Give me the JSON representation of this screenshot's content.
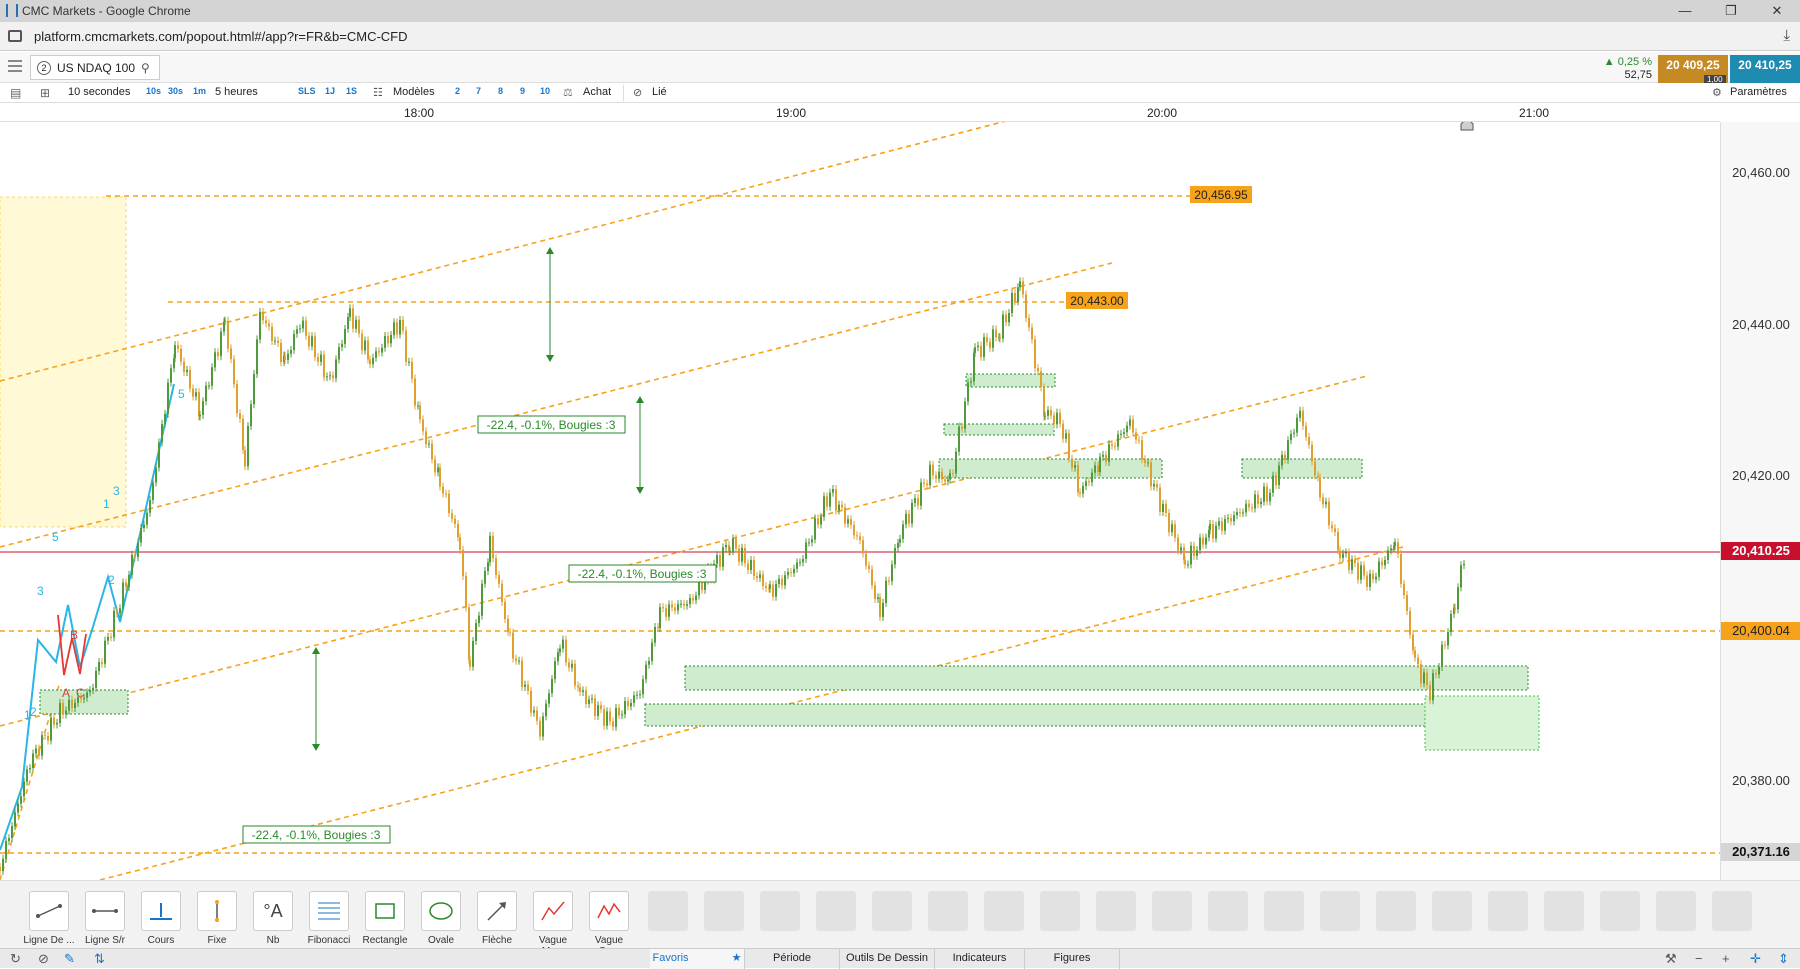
{
  "window": {
    "title": "CMC Markets - Google Chrome",
    "minimize": "—",
    "maximize": "❐",
    "close": "✕"
  },
  "browser": {
    "url": "platform.cmcmarkets.com/popout.html#/app?r=FR&b=CMC-CFD"
  },
  "instrument": {
    "number": "2",
    "name": "US NDAQ 100"
  },
  "quote": {
    "change_pct": "▲ 0,25 %",
    "change_pts": "52,75",
    "bid": "20 409,25",
    "ask": "20 410,25",
    "spread": "1,00"
  },
  "toolbar": {
    "interval": "10 secondes",
    "i10s": "10s",
    "i30s": "30s",
    "i1m": "1m",
    "range": "5 heures",
    "sls": "SLS",
    "r1j": "1J",
    "r1s": "1S",
    "models": "Modèles",
    "n2": "2",
    "n7": "7",
    "n8": "8",
    "n9": "9",
    "n10": "10",
    "buy": "Achat",
    "linked": "Lié",
    "settings": "Paramètres"
  },
  "time_axis": [
    "18:00",
    "19:00",
    "20:00",
    "21:00"
  ],
  "price_axis": {
    "ticks": [
      "20,460.00",
      "20,440.00",
      "20,420.00",
      "20,380.00"
    ],
    "current": "20,410.25",
    "level_400": "20,400.04",
    "level_371": "20,371.16"
  },
  "chart_labels": {
    "level_456": "20,456.95",
    "level_443": "20,443.00",
    "measure": "-22.4, -0.1%, Bougies :3",
    "wave": {
      "a": "A",
      "b": "B",
      "c": "C",
      "w1": "1",
      "w2": "2",
      "w3": "3",
      "w5": "5",
      "w5b": "5"
    }
  },
  "colors": {
    "orange": "#f6a21b",
    "current_line": "#c8102e",
    "zone_fill": "#cfeccf",
    "zone_border": "#2a8a2a",
    "candle_up": "#4f9a3b",
    "candle_down": "#e0a030"
  },
  "drawing_tools": [
    "Ligne De ...",
    "Ligne S/r",
    "Cours",
    "Fixe",
    "Nb",
    "Fibonacci",
    "Rectangle",
    "Ovale",
    "Flèche",
    "Vague Mo...",
    "Vague Co..."
  ],
  "bottom_tabs": {
    "favorites": "Favoris",
    "period": "Période",
    "drawing": "Outils De Dessin",
    "indicators": "Indicateurs",
    "figures": "Figures"
  }
}
